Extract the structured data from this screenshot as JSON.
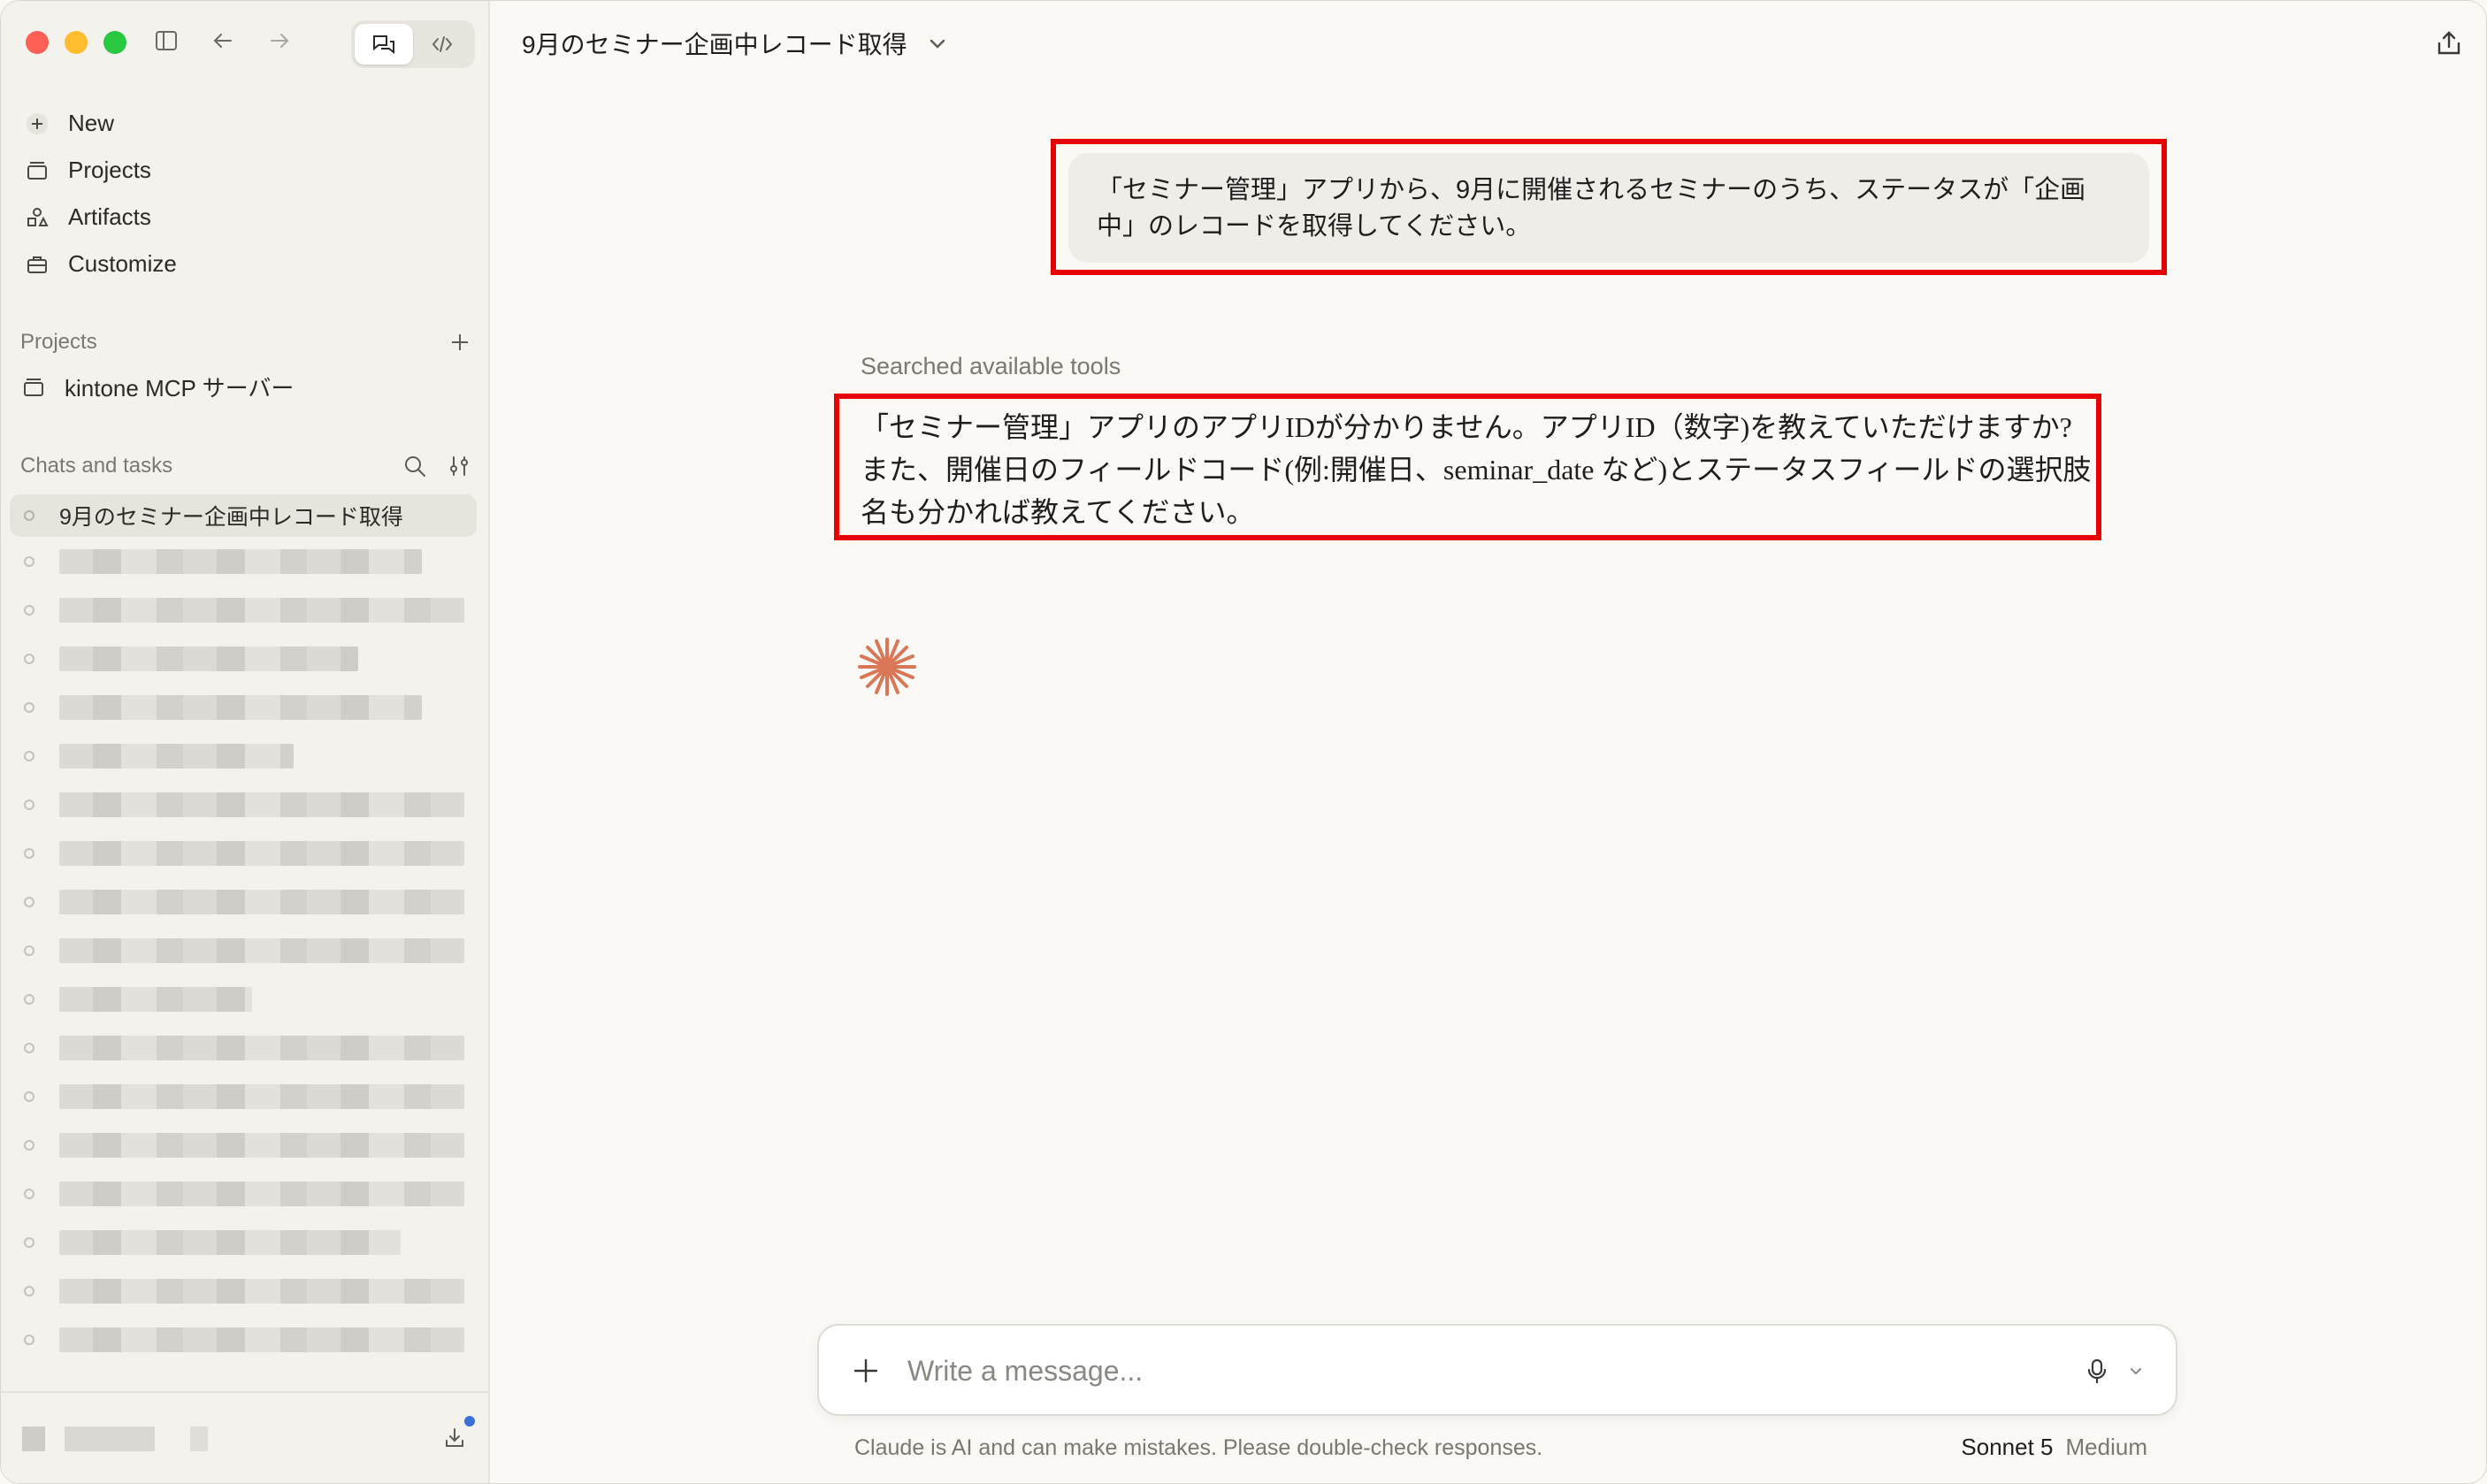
{
  "sidebar": {
    "nav": [
      {
        "label": "New",
        "icon": "plus-icon"
      },
      {
        "label": "Projects",
        "icon": "folder-icon"
      },
      {
        "label": "Artifacts",
        "icon": "artifacts-icon"
      },
      {
        "label": "Customize",
        "icon": "briefcase-icon"
      }
    ],
    "projects_header": "Projects",
    "projects": [
      {
        "label": "kintone MCP サーバー",
        "icon": "folder-icon"
      }
    ],
    "chats_header": "Chats and tasks",
    "active_chat": "9月のセミナー企画中レコード取得",
    "blurred_rows": 18
  },
  "header": {
    "title": "9月のセミナー企画中レコード取得"
  },
  "conversation": {
    "user_message": "「セミナー管理」アプリから、9月に開催されるセミナーのうち、ステータスが「企画中」のレコードを取得してください。",
    "tool_status": "Searched available tools",
    "assistant_message": "「セミナー管理」アプリのアプリIDが分かりません。アプリID（数字)を教えていただけますか?また、開催日のフィールドコード(例:開催日、seminar_date など)とステータスフィールドの選択肢名も分かれば教えてください。"
  },
  "composer": {
    "placeholder": "Write a message...",
    "disclaimer": "Claude is AI and can make mistakes. Please double-check responses.",
    "model": "Sonnet 5",
    "effort": "Medium"
  },
  "colors": {
    "highlight_border": "#e60000",
    "accent_spark": "#d97757",
    "notification_dot": "#3b6fd8"
  }
}
